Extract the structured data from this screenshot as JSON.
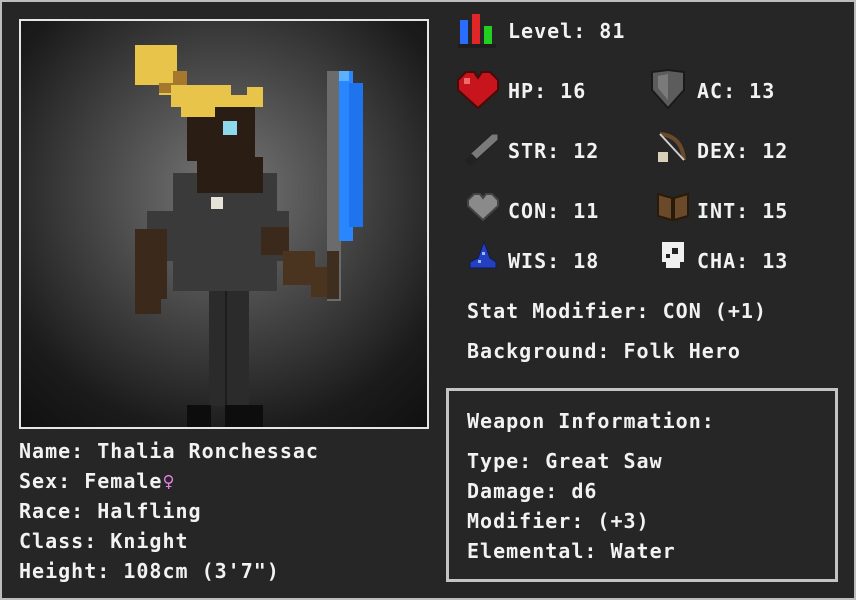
{
  "stats": {
    "level": {
      "label": "Level:",
      "value": "81"
    },
    "hp": {
      "label": "HP:",
      "value": "16"
    },
    "ac": {
      "label": "AC:",
      "value": "13"
    },
    "str": {
      "label": "STR:",
      "value": "12"
    },
    "dex": {
      "label": "DEX:",
      "value": "12"
    },
    "con": {
      "label": "CON:",
      "value": "11"
    },
    "int": {
      "label": "INT:",
      "value": "15"
    },
    "wis": {
      "label": "WIS:",
      "value": "18"
    },
    "cha": {
      "label": "CHA:",
      "value": "13"
    }
  },
  "stat_modifier": {
    "label": "Stat Modifier:",
    "value": "CON (+1)"
  },
  "background": {
    "label": "Background:",
    "value": "Folk Hero"
  },
  "character": {
    "name": {
      "label": "Name:",
      "value": "Thalia Ronchessac"
    },
    "sex": {
      "label": "Sex:",
      "value": "Female",
      "symbol": "♀"
    },
    "race": {
      "label": "Race:",
      "value": "Halfling"
    },
    "class": {
      "label": "Class:",
      "value": "Knight"
    },
    "height": {
      "label": "Height:",
      "value": "108cm (3'7\")"
    }
  },
  "weapon": {
    "title": "Weapon Information:",
    "type": {
      "label": "Type:",
      "value": "Great Saw"
    },
    "damage": {
      "label": "Damage:",
      "value": "d6"
    },
    "modifier": {
      "label": "Modifier:",
      "value": "(+3)"
    },
    "elemental": {
      "label": "Elemental:",
      "value": "Water"
    }
  },
  "colors": {
    "frame": "#bdbdbd",
    "background": "#262626",
    "text": "#f2f2f2",
    "female_symbol": "#e67ee6",
    "blade": "#2a86ff",
    "hair": "#e8c44a"
  },
  "icons": [
    "level-bars-icon",
    "heart-icon",
    "shield-icon",
    "sword-icon",
    "bow-icon",
    "stone-heart-icon",
    "book-icon",
    "wizard-hat-icon",
    "skull-icon"
  ]
}
